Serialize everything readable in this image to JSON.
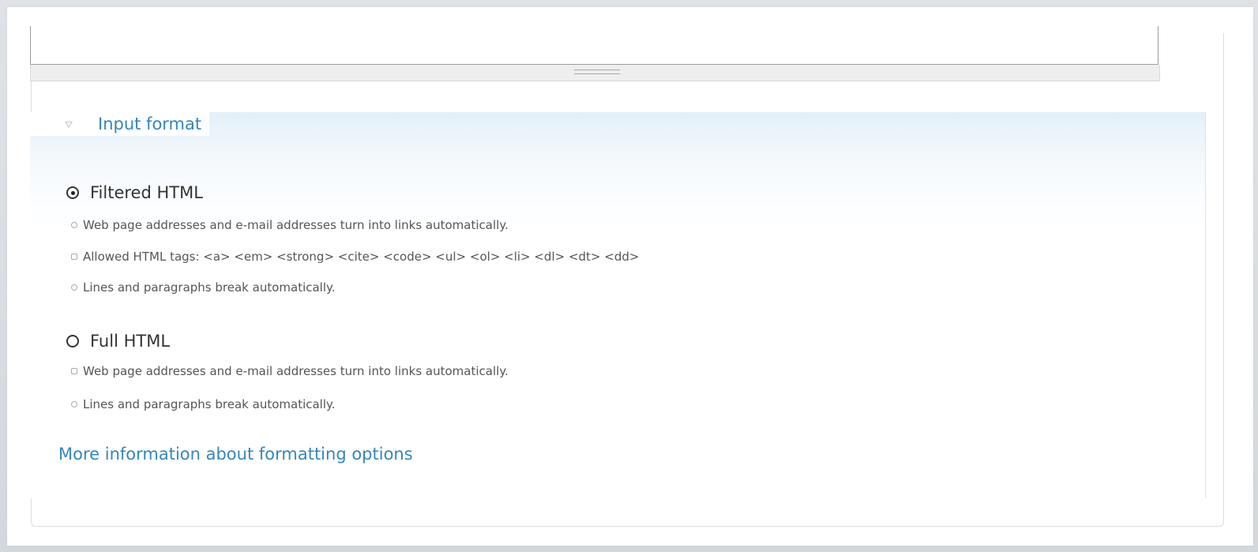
{
  "input_format": {
    "legend": "Input format",
    "options": [
      {
        "label": "Filtered HTML",
        "checked": true,
        "tips": [
          "Web page addresses and e-mail addresses turn into links automatically.",
          "Allowed HTML tags: <a> <em> <strong> <cite> <code> <ul> <ol> <li> <dl> <dt> <dd>",
          "Lines and paragraphs break automatically."
        ]
      },
      {
        "label": "Full HTML",
        "checked": false,
        "tips": [
          "Web page addresses and e-mail addresses turn into links automatically.",
          "Lines and paragraphs break automatically."
        ]
      }
    ],
    "more_info_link": "More information about formatting options"
  },
  "colors": {
    "link": "#3486be",
    "fieldset_tint": "#e3f0f9",
    "text": "#333333"
  },
  "icons": {
    "collapse": "triangle-down-icon",
    "resize": "grippie-icon",
    "radio": "radio-icon",
    "bullet": "bullet-icon"
  }
}
